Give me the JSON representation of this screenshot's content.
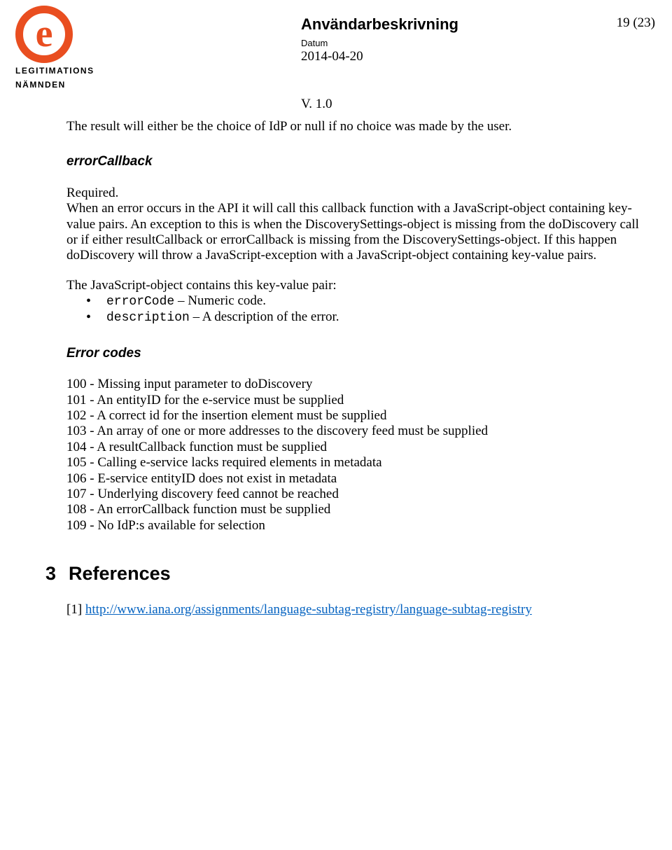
{
  "header": {
    "logo_line1": "LEGITIMATIONS",
    "logo_line2": "NÄMNDEN",
    "doc_title": "Användarbeskrivning",
    "datum_label": "Datum",
    "date": "2014-04-20",
    "version": "V. 1.0",
    "page_number": "19 (23)"
  },
  "body": {
    "intro_para": "The result will either be the choice of IdP or null if no choice was made by the user.",
    "errorCallback": {
      "heading": "errorCallback",
      "required": "Required.",
      "para1": "When an error occurs in the API it will call this callback function with a JavaScript-object containing key-value pairs. An exception to this is when the DiscoverySettings-object is missing from the doDiscovery call or if either resultCallback or errorCallback is missing from the DiscoverySettings-object. If this happen doDiscovery will throw a JavaScript-exception with a JavaScript-object containing key-value pairs.",
      "para2_lead": "The JavaScript-object contains this key-value pair:",
      "bullets": [
        {
          "code": "errorCode",
          "rest": " – Numeric code."
        },
        {
          "code": "description",
          "rest": " – A description of the error."
        }
      ]
    },
    "errorCodes": {
      "heading": "Error codes",
      "items": [
        "100 - Missing input parameter to doDiscovery",
        "101 - An entityID for the e-service must be supplied",
        "102 - A correct id for the insertion element must be supplied",
        "103 - An array of one or more addresses to the discovery feed must be supplied",
        "104 - A resultCallback function must be supplied",
        "105 - Calling e-service lacks required elements in metadata",
        "106 - E-service entityID does not exist in metadata",
        "107 - Underlying discovery feed cannot be reached",
        "108 - An errorCallback function must be supplied",
        "109 - No IdP:s available for selection"
      ]
    },
    "references": {
      "number": "3",
      "title": "References",
      "item_label": "[1] ",
      "link_text": "http://www.iana.org/assignments/language-subtag-registry/language-subtag-registry"
    }
  }
}
